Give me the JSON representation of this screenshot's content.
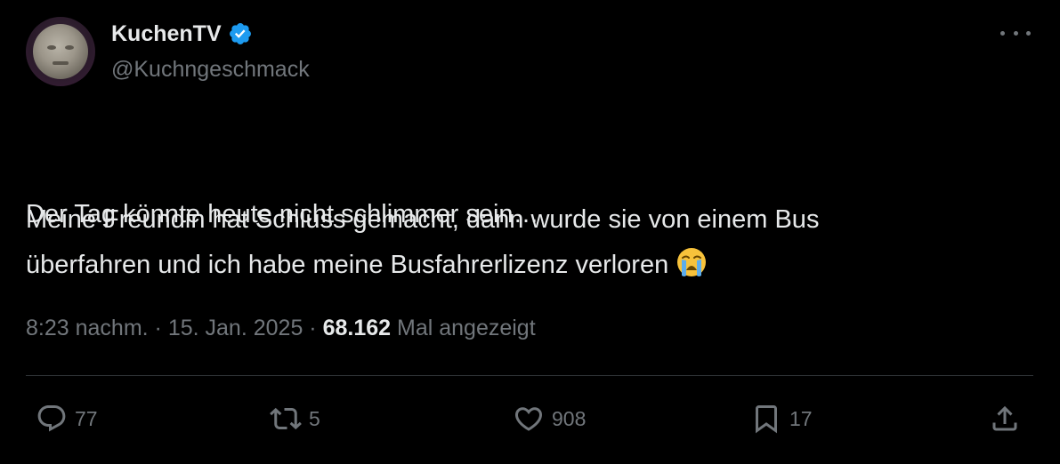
{
  "author": {
    "display_name": "KuchenTV",
    "handle": "@Kuchngeschmack",
    "verified": true,
    "verified_color": "#1d9bf0",
    "avatar_icon": "avatar-image"
  },
  "more_icon": "more-horizontal-icon",
  "tweet": {
    "line1": "Der Tag könnte heute nicht schlimmer sein…",
    "line2": "Meine Freundin hat Schluss gemacht, dann wurde sie von einem Bus",
    "line3": "überfahren und ich habe meine Busfahrerlizenz verloren",
    "emoji": "loudly-crying-face-emoji"
  },
  "meta": {
    "time": "8:23 nachm.",
    "separator": "·",
    "date": "15. Jan. 2025",
    "views_count": "68.162",
    "views_label": "Mal angezeigt"
  },
  "actions": {
    "reply": {
      "icon": "reply-icon",
      "count": "77"
    },
    "retweet": {
      "icon": "retweet-icon",
      "count": "5"
    },
    "like": {
      "icon": "heart-icon",
      "count": "908"
    },
    "bookmark": {
      "icon": "bookmark-icon",
      "count": "17"
    },
    "share": {
      "icon": "share-icon"
    }
  },
  "colors": {
    "background": "#000000",
    "text_primary": "#e7e9ea",
    "text_secondary": "#71767b",
    "divider": "#2f3336"
  }
}
